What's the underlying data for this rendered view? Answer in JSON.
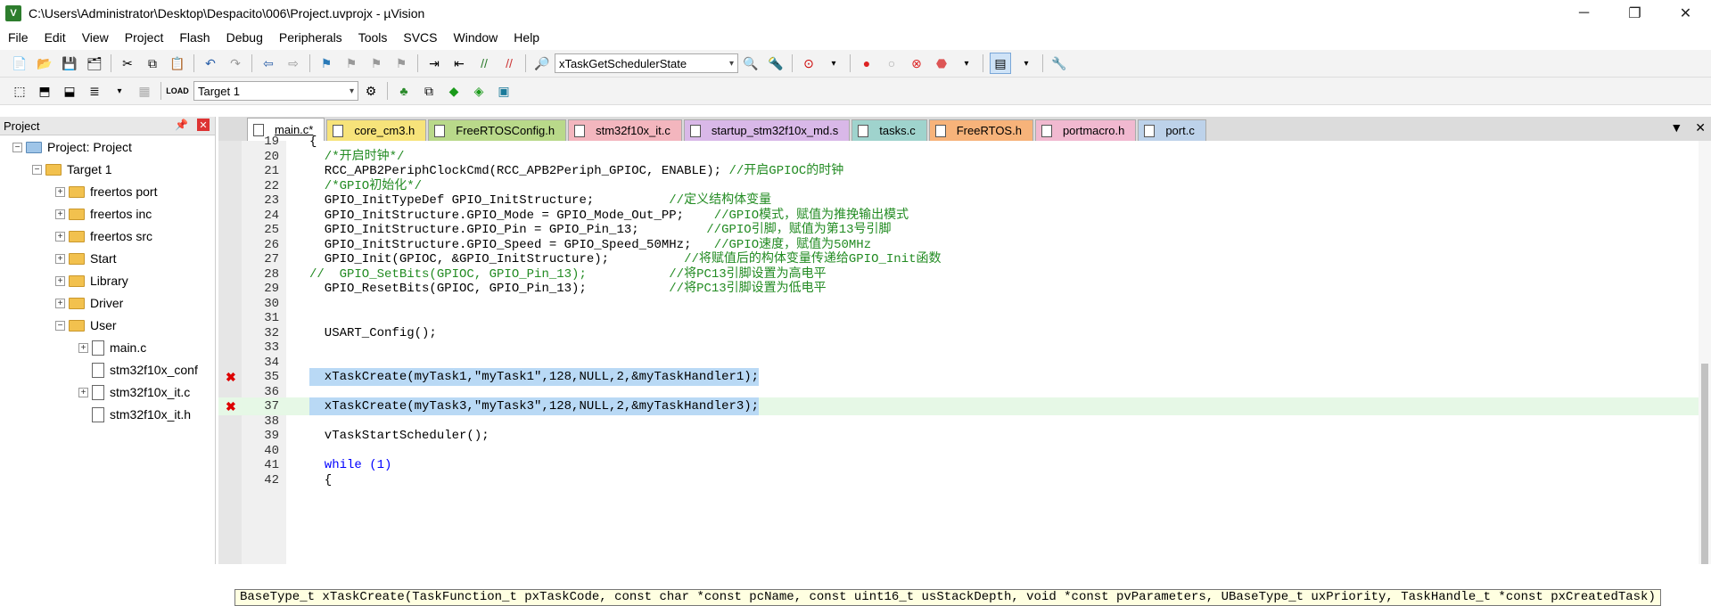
{
  "window": {
    "title": "C:\\Users\\Administrator\\Desktop\\Despacito\\006\\Project.uvprojx - µVision",
    "app_icon_letter": "V"
  },
  "menu": [
    "File",
    "Edit",
    "View",
    "Project",
    "Flash",
    "Debug",
    "Peripherals",
    "Tools",
    "SVCS",
    "Window",
    "Help"
  ],
  "toolbar": {
    "find_combo_value": "xTaskGetSchedulerState"
  },
  "toolbar2": {
    "target_combo_value": "Target 1"
  },
  "project_panel": {
    "title": "Project",
    "tree": [
      {
        "label": "Project: Project",
        "expander": "−",
        "icon": "project-icon"
      },
      {
        "label": "Target 1",
        "expander": "−",
        "icon": "target-folder-icon"
      },
      {
        "label": "freertos port",
        "expander": "+",
        "icon": "folder-icon"
      },
      {
        "label": "freertos inc",
        "expander": "+",
        "icon": "folder-icon"
      },
      {
        "label": "freertos src",
        "expander": "+",
        "icon": "folder-icon"
      },
      {
        "label": "Start",
        "expander": "+",
        "icon": "folder-icon"
      },
      {
        "label": "Library",
        "expander": "+",
        "icon": "folder-icon"
      },
      {
        "label": "Driver",
        "expander": "+",
        "icon": "folder-icon"
      },
      {
        "label": "User",
        "expander": "−",
        "icon": "folder-icon"
      },
      {
        "label": "main.c",
        "expander": "+",
        "icon": "file-icon"
      },
      {
        "label": "stm32f10x_conf",
        "expander": "",
        "icon": "file-icon"
      },
      {
        "label": "stm32f10x_it.c",
        "expander": "+",
        "icon": "file-icon"
      },
      {
        "label": "stm32f10x_it.h",
        "expander": "",
        "icon": "file-icon"
      }
    ]
  },
  "tabs": [
    {
      "label": "main.c*",
      "color": "#ffffff",
      "active": true
    },
    {
      "label": "core_cm3.h",
      "color": "#f7e37a"
    },
    {
      "label": "FreeRTOSConfig.h",
      "color": "#b9d98a"
    },
    {
      "label": "stm32f10x_it.c",
      "color": "#f3b6be"
    },
    {
      "label": "startup_stm32f10x_md.s",
      "color": "#d9b8e8"
    },
    {
      "label": "tasks.c",
      "color": "#9fd3cd"
    },
    {
      "label": "FreeRTOS.h",
      "color": "#f7b37a"
    },
    {
      "label": "portmacro.h",
      "color": "#f1b9d0"
    },
    {
      "label": "port.c",
      "color": "#bdd2ea"
    }
  ],
  "code_lines": [
    {
      "n": "19",
      "text": "{"
    },
    {
      "n": "20",
      "text": "  /*开启时钟*/"
    },
    {
      "n": "21",
      "text": "  RCC_APB2PeriphClockCmd(RCC_APB2Periph_GPIOC, ENABLE); //开启GPIOC的时钟"
    },
    {
      "n": "22",
      "text": "  /*GPIO初始化*/"
    },
    {
      "n": "23",
      "text": "  GPIO_InitTypeDef GPIO_InitStructure;          //定义结构体变量"
    },
    {
      "n": "24",
      "text": "  GPIO_InitStructure.GPIO_Mode = GPIO_Mode_Out_PP;    //GPIO模式，赋值为推挽输出模式"
    },
    {
      "n": "25",
      "text": "  GPIO_InitStructure.GPIO_Pin = GPIO_Pin_13;         //GPIO引脚，赋值为第13号引脚"
    },
    {
      "n": "26",
      "text": "  GPIO_InitStructure.GPIO_Speed = GPIO_Speed_50MHz;   //GPIO速度，赋值为50MHz"
    },
    {
      "n": "27",
      "text": "  GPIO_Init(GPIOC, &GPIO_InitStructure);          //将赋值后的构体变量传递给GPIO_Init函数"
    },
    {
      "n": "28",
      "text": "//  GPIO_SetBits(GPIOC, GPIO_Pin_13);           //将PC13引脚设置为高电平"
    },
    {
      "n": "29",
      "text": "  GPIO_ResetBits(GPIOC, GPIO_Pin_13);           //将PC13引脚设置为低电平"
    },
    {
      "n": "30",
      "text": ""
    },
    {
      "n": "31",
      "text": ""
    },
    {
      "n": "32",
      "text": "  USART_Config();"
    },
    {
      "n": "33",
      "text": ""
    },
    {
      "n": "34",
      "text": ""
    },
    {
      "n": "35",
      "text": "  xTaskCreate(myTask1,\"myTask1\",128,NULL,2,&myTaskHandler1);"
    },
    {
      "n": "36",
      "text": ""
    },
    {
      "n": "37",
      "text": "  xTaskCreate(myTask3,\"myTask3\",128,NULL,2,&myTaskHandler3);"
    },
    {
      "n": "38",
      "text": ""
    },
    {
      "n": "39",
      "text": "  vTaskStartScheduler();"
    },
    {
      "n": "40",
      "text": ""
    },
    {
      "n": "41",
      "text": "  while (1)"
    },
    {
      "n": "42",
      "text": "  {"
    }
  ],
  "tooltip": "BaseType_t xTaskCreate(TaskFunction_t pxTaskCode, const char *const pcName, const uint16_t usStackDepth, void *const pvParameters, UBaseType_t uxPriority, TaskHandle_t *const pxCreatedTask)",
  "error_icon": "✖"
}
